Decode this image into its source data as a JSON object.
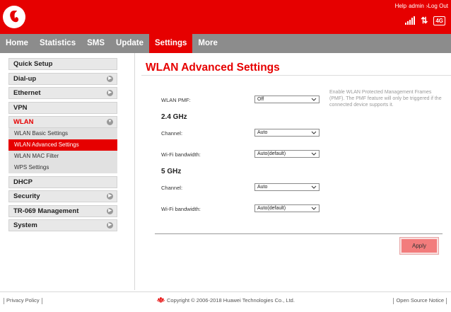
{
  "header": {
    "links": {
      "help": "Help",
      "admin": "admin",
      "logout": "Log Out"
    },
    "network_type": "4G",
    "colors": {
      "brand": "#e60000"
    }
  },
  "nav": {
    "tabs": [
      {
        "label": "Home"
      },
      {
        "label": "Statistics"
      },
      {
        "label": "SMS"
      },
      {
        "label": "Update"
      },
      {
        "label": "Settings",
        "active": true
      },
      {
        "label": "More"
      }
    ]
  },
  "sidebar": {
    "items": [
      {
        "label": "Quick Setup"
      },
      {
        "label": "Dial-up"
      },
      {
        "label": "Ethernet"
      },
      {
        "label": "VPN"
      },
      {
        "label": "WLAN",
        "expanded": true
      },
      {
        "label": "DHCP"
      },
      {
        "label": "Security"
      },
      {
        "label": "TR-069 Management"
      },
      {
        "label": "System"
      }
    ],
    "wlan_sub": [
      {
        "label": "WLAN Basic Settings"
      },
      {
        "label": "WLAN Advanced Settings",
        "active": true
      },
      {
        "label": "WLAN MAC Filter"
      },
      {
        "label": "WPS Settings"
      }
    ]
  },
  "main": {
    "title": "WLAN Advanced Settings",
    "pmf": {
      "label": "WLAN PMF:",
      "value": "Off",
      "note": "Enable WLAN Protected Management Frames (PMF). The PMF feature will only be triggered if the connected device supports it."
    },
    "band24": {
      "heading": "2.4 GHz",
      "channel_label": "Channel:",
      "channel_value": "Auto",
      "bandwidth_label": "Wi-Fi bandwidth:",
      "bandwidth_value": "Auto(default)"
    },
    "band5": {
      "heading": "5 GHz",
      "channel_label": "Channel:",
      "channel_value": "Auto",
      "bandwidth_label": "Wi-Fi bandwidth:",
      "bandwidth_value": "Auto(default)"
    },
    "apply_label": "Apply"
  },
  "footer": {
    "privacy": "Privacy Policy",
    "copyright": "Copyright © 2006-2018 Huawei Technologies Co., Ltd.",
    "open_source": "Open Source Notice"
  }
}
